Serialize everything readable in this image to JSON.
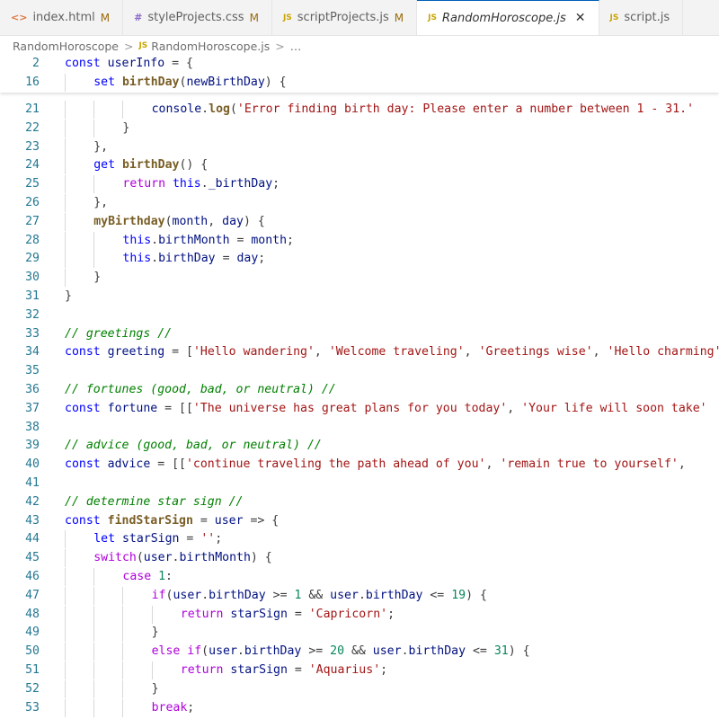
{
  "tabs": [
    {
      "label": "index.html",
      "icon": "html-file-icon",
      "modified": "M"
    },
    {
      "label": "styleProjects.css",
      "icon": "css-file-icon",
      "modified": "M"
    },
    {
      "label": "scriptProjects.js",
      "icon": "js-file-icon",
      "modified": "M"
    },
    {
      "label": "RandomHoroscope.js",
      "icon": "js-file-icon",
      "active": true
    },
    {
      "label": "script.js",
      "icon": "js-file-icon"
    }
  ],
  "icon_glyphs": {
    "html": "<>",
    "css": "#",
    "js": "JS",
    "close": "✕"
  },
  "breadcrumb": {
    "folder": "RandomHoroscope",
    "file": "RandomHoroscope.js",
    "more": "…",
    "sep": ">"
  },
  "sticky_lines": [
    {
      "num": "2",
      "indent": 0,
      "tokens": [
        [
          "k",
          "const "
        ],
        [
          "v",
          "userInfo"
        ],
        [
          "p",
          " = {"
        ]
      ]
    },
    {
      "num": "16",
      "indent": 1,
      "tokens": [
        [
          "k",
          "set "
        ],
        [
          "fn",
          "birthDay"
        ],
        [
          "p",
          "("
        ],
        [
          "v",
          "newBirthDay"
        ],
        [
          "p",
          ") {"
        ]
      ]
    }
  ],
  "code_lines": [
    {
      "num": "21",
      "indent": 3,
      "tokens": [
        [
          "v",
          "console"
        ],
        [
          "p",
          "."
        ],
        [
          "fn",
          "log"
        ],
        [
          "p",
          "("
        ],
        [
          "s",
          "'Error finding birth day: Please enter a number between 1 - 31.'"
        ]
      ]
    },
    {
      "num": "22",
      "indent": 2,
      "tokens": [
        [
          "p",
          "}"
        ]
      ]
    },
    {
      "num": "23",
      "indent": 1,
      "tokens": [
        [
          "p",
          "},"
        ]
      ]
    },
    {
      "num": "24",
      "indent": 1,
      "tokens": [
        [
          "k",
          "get "
        ],
        [
          "fn",
          "birthDay"
        ],
        [
          "p",
          "() {"
        ]
      ]
    },
    {
      "num": "25",
      "indent": 2,
      "tokens": [
        [
          "kc",
          "return "
        ],
        [
          "k",
          "this"
        ],
        [
          "p",
          "."
        ],
        [
          "v",
          "_birthDay"
        ],
        [
          "p",
          ";"
        ]
      ]
    },
    {
      "num": "26",
      "indent": 1,
      "tokens": [
        [
          "p",
          "},"
        ]
      ]
    },
    {
      "num": "27",
      "indent": 1,
      "tokens": [
        [
          "fn",
          "myBirthday"
        ],
        [
          "p",
          "("
        ],
        [
          "v",
          "month"
        ],
        [
          "p",
          ", "
        ],
        [
          "v",
          "day"
        ],
        [
          "p",
          ") {"
        ]
      ]
    },
    {
      "num": "28",
      "indent": 2,
      "tokens": [
        [
          "k",
          "this"
        ],
        [
          "p",
          "."
        ],
        [
          "v",
          "birthMonth"
        ],
        [
          "p",
          " = "
        ],
        [
          "v",
          "month"
        ],
        [
          "p",
          ";"
        ]
      ]
    },
    {
      "num": "29",
      "indent": 2,
      "tokens": [
        [
          "k",
          "this"
        ],
        [
          "p",
          "."
        ],
        [
          "v",
          "birthDay"
        ],
        [
          "p",
          " = "
        ],
        [
          "v",
          "day"
        ],
        [
          "p",
          ";"
        ]
      ]
    },
    {
      "num": "30",
      "indent": 1,
      "tokens": [
        [
          "p",
          "}"
        ]
      ]
    },
    {
      "num": "31",
      "indent": 0,
      "tokens": [
        [
          "p",
          "}"
        ]
      ]
    },
    {
      "num": "32",
      "indent": 0,
      "tokens": []
    },
    {
      "num": "33",
      "indent": 0,
      "tokens": [
        [
          "c",
          "// greetings //"
        ]
      ]
    },
    {
      "num": "34",
      "indent": 0,
      "tokens": [
        [
          "k",
          "const "
        ],
        [
          "v",
          "greeting"
        ],
        [
          "p",
          " = ["
        ],
        [
          "s",
          "'Hello wandering'"
        ],
        [
          "p",
          ", "
        ],
        [
          "s",
          "'Welcome traveling'"
        ],
        [
          "p",
          ", "
        ],
        [
          "s",
          "'Greetings wise'"
        ],
        [
          "p",
          ", "
        ],
        [
          "s",
          "'Hello charming'"
        ]
      ]
    },
    {
      "num": "35",
      "indent": 0,
      "tokens": []
    },
    {
      "num": "36",
      "indent": 0,
      "tokens": [
        [
          "c",
          "// fortunes (good, bad, or neutral) //"
        ]
      ]
    },
    {
      "num": "37",
      "indent": 0,
      "tokens": [
        [
          "k",
          "const "
        ],
        [
          "v",
          "fortune"
        ],
        [
          "p",
          " = [["
        ],
        [
          "s",
          "'The universe has great plans for you today'"
        ],
        [
          "p",
          ", "
        ],
        [
          "s",
          "'Your life will soon take'"
        ]
      ]
    },
    {
      "num": "38",
      "indent": 0,
      "tokens": []
    },
    {
      "num": "39",
      "indent": 0,
      "tokens": [
        [
          "c",
          "// advice (good, bad, or neutral) //"
        ]
      ]
    },
    {
      "num": "40",
      "indent": 0,
      "tokens": [
        [
          "k",
          "const "
        ],
        [
          "v",
          "advice"
        ],
        [
          "p",
          " = [["
        ],
        [
          "s",
          "'continue traveling the path ahead of you'"
        ],
        [
          "p",
          ", "
        ],
        [
          "s",
          "'remain true to yourself'"
        ],
        [
          "p",
          ","
        ]
      ]
    },
    {
      "num": "41",
      "indent": 0,
      "tokens": []
    },
    {
      "num": "42",
      "indent": 0,
      "tokens": [
        [
          "c",
          "// determine star sign //"
        ]
      ]
    },
    {
      "num": "43",
      "indent": 0,
      "tokens": [
        [
          "k",
          "const "
        ],
        [
          "fn",
          "findStarSign"
        ],
        [
          "p",
          " = "
        ],
        [
          "v",
          "user"
        ],
        [
          "p",
          " => {"
        ]
      ]
    },
    {
      "num": "44",
      "indent": 1,
      "tokens": [
        [
          "k",
          "let "
        ],
        [
          "v",
          "starSign"
        ],
        [
          "p",
          " = "
        ],
        [
          "s",
          "''"
        ],
        [
          "p",
          ";"
        ]
      ]
    },
    {
      "num": "45",
      "indent": 1,
      "tokens": [
        [
          "kc",
          "switch"
        ],
        [
          "p",
          "("
        ],
        [
          "v",
          "user"
        ],
        [
          "p",
          "."
        ],
        [
          "v",
          "birthMonth"
        ],
        [
          "p",
          ") {"
        ]
      ]
    },
    {
      "num": "46",
      "indent": 2,
      "tokens": [
        [
          "kc",
          "case "
        ],
        [
          "n",
          "1"
        ],
        [
          "p",
          ":"
        ]
      ]
    },
    {
      "num": "47",
      "indent": 3,
      "tokens": [
        [
          "kc",
          "if"
        ],
        [
          "p",
          "("
        ],
        [
          "v",
          "user"
        ],
        [
          "p",
          "."
        ],
        [
          "v",
          "birthDay"
        ],
        [
          "p",
          " >= "
        ],
        [
          "n",
          "1"
        ],
        [
          "p",
          " && "
        ],
        [
          "v",
          "user"
        ],
        [
          "p",
          "."
        ],
        [
          "v",
          "birthDay"
        ],
        [
          "p",
          " <= "
        ],
        [
          "n",
          "19"
        ],
        [
          "p",
          ") {"
        ]
      ]
    },
    {
      "num": "48",
      "indent": 4,
      "tokens": [
        [
          "kc",
          "return "
        ],
        [
          "v",
          "starSign"
        ],
        [
          "p",
          " = "
        ],
        [
          "s",
          "'Capricorn'"
        ],
        [
          "p",
          ";"
        ]
      ]
    },
    {
      "num": "49",
      "indent": 3,
      "tokens": [
        [
          "p",
          "}"
        ]
      ]
    },
    {
      "num": "50",
      "indent": 3,
      "tokens": [
        [
          "kc",
          "else if"
        ],
        [
          "p",
          "("
        ],
        [
          "v",
          "user"
        ],
        [
          "p",
          "."
        ],
        [
          "v",
          "birthDay"
        ],
        [
          "p",
          " >= "
        ],
        [
          "n",
          "20"
        ],
        [
          "p",
          " && "
        ],
        [
          "v",
          "user"
        ],
        [
          "p",
          "."
        ],
        [
          "v",
          "birthDay"
        ],
        [
          "p",
          " <= "
        ],
        [
          "n",
          "31"
        ],
        [
          "p",
          ") {"
        ]
      ]
    },
    {
      "num": "51",
      "indent": 4,
      "tokens": [
        [
          "kc",
          "return "
        ],
        [
          "v",
          "starSign"
        ],
        [
          "p",
          " = "
        ],
        [
          "s",
          "'Aquarius'"
        ],
        [
          "p",
          ";"
        ]
      ]
    },
    {
      "num": "52",
      "indent": 3,
      "tokens": [
        [
          "p",
          "}"
        ]
      ]
    },
    {
      "num": "53",
      "indent": 3,
      "tokens": [
        [
          "kc",
          "break"
        ],
        [
          "p",
          ";"
        ]
      ]
    }
  ]
}
